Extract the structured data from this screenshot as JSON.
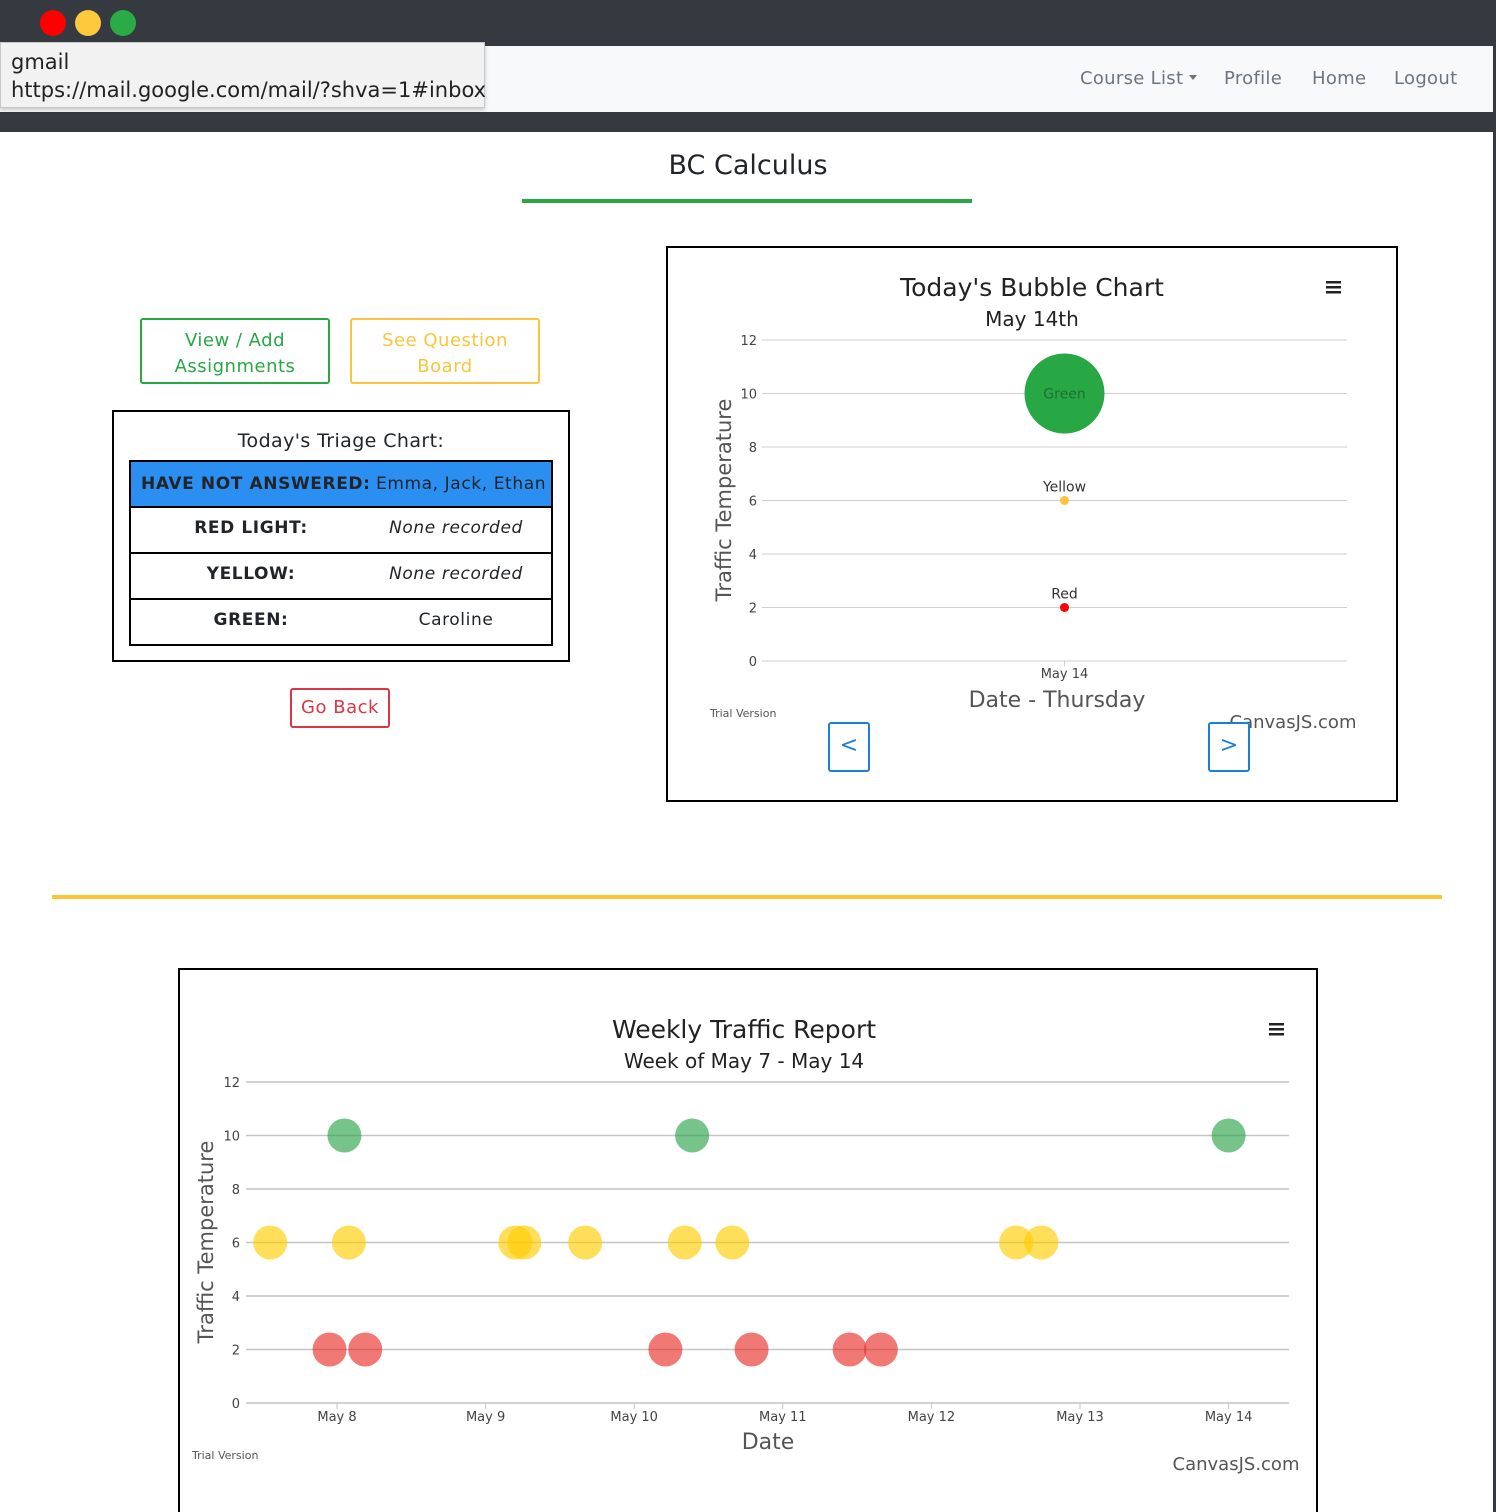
{
  "tooltip": {
    "title": "gmail",
    "url": "https://mail.google.com/mail/?shva=1#inbox"
  },
  "navbar": {
    "course_list": "Course List",
    "profile": "Profile",
    "home": "Home",
    "logout": "Logout"
  },
  "page": {
    "title": "BC Calculus",
    "view_add_line1": "View / Add",
    "view_add_line2": "Assignments",
    "question_line1": "See Question",
    "question_line2": "Board",
    "go_back": "Go Back"
  },
  "triage": {
    "title": "Today's Triage Chart:",
    "rows": [
      {
        "label": "HAVE NOT ANSWERED:",
        "value": "Emma, Jack, Ethan"
      },
      {
        "label": "RED LIGHT:",
        "value": "None recorded"
      },
      {
        "label": "YELLOW:",
        "value": "None recorded"
      },
      {
        "label": "GREEN:",
        "value": "Caroline"
      }
    ]
  },
  "bubble_nav": {
    "prev": "<",
    "next": ">"
  },
  "credits": {
    "trial": "Trial Version",
    "canvasjs": "CanvasJS.com"
  },
  "colors": {
    "green": "#28a745",
    "yellow": "#fbc43a",
    "red": "#dc3545",
    "highlight_blue": "#2b8ff1",
    "nav_blue": "#1b7fd6"
  },
  "chart_data": [
    {
      "type": "bubble",
      "title": "Today's Bubble Chart",
      "subtitle": "May 14th",
      "xlabel": "Date - Thursday",
      "ylabel": "Traffic Temperature",
      "ylim": [
        0,
        12
      ],
      "yticks": [
        0,
        2,
        4,
        6,
        8,
        10,
        12
      ],
      "categories": [
        "May 14"
      ],
      "grid": true,
      "points": [
        {
          "label": "Green",
          "category": "May 14",
          "y": 10,
          "size": 1,
          "color": "#28a745"
        },
        {
          "label": "Yellow",
          "category": "May 14",
          "y": 6,
          "size": 0,
          "color": "#fbc43a"
        },
        {
          "label": "Red",
          "category": "May 14",
          "y": 2,
          "size": 0,
          "color": "#ff0000"
        }
      ]
    },
    {
      "type": "scatter",
      "title": "Weekly Traffic Report",
      "subtitle": "Week of May 7 - May 14",
      "xlabel": "Date",
      "ylabel": "Traffic Temperature",
      "ylim": [
        0,
        12
      ],
      "yticks": [
        0,
        2,
        4,
        6,
        8,
        10,
        12
      ],
      "xticks": [
        "May 8",
        "May 9",
        "May 10",
        "May 11",
        "May 12",
        "May 13",
        "May 14"
      ],
      "grid": true,
      "series": [
        {
          "color": "#ffcc00",
          "points": [
            [
              7.55,
              6
            ],
            [
              8.08,
              6
            ],
            [
              9.2,
              6
            ],
            [
              9.26,
              6
            ],
            [
              9.67,
              6
            ],
            [
              10.34,
              6
            ],
            [
              10.66,
              6
            ],
            [
              12.57,
              6
            ],
            [
              12.74,
              6
            ]
          ]
        },
        {
          "color": "#e8312c",
          "points": [
            [
              7.95,
              2
            ],
            [
              8.19,
              2
            ],
            [
              10.21,
              2
            ],
            [
              10.79,
              2
            ],
            [
              11.45,
              2
            ],
            [
              11.66,
              2
            ]
          ]
        },
        {
          "color": "#2ca44b",
          "points": [
            [
              8.05,
              10
            ],
            [
              10.39,
              10
            ],
            [
              14.0,
              10
            ]
          ]
        }
      ]
    }
  ]
}
